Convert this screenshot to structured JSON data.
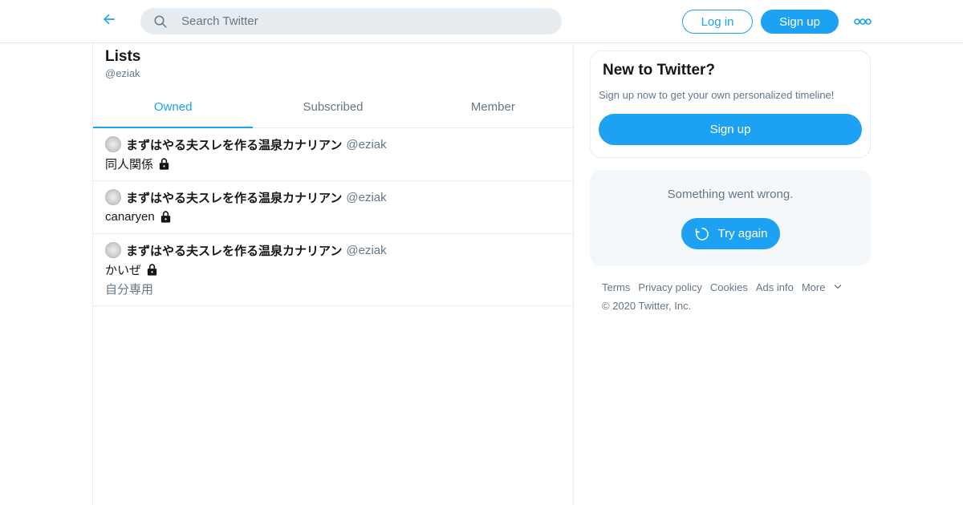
{
  "colors": {
    "accent": "#1da1f2",
    "text_primary": "#14171a",
    "text_secondary": "#657786",
    "border": "#e6ecf0",
    "search_bg": "#e6ecf0",
    "card_bg": "#f5f8fa"
  },
  "header": {
    "back_icon": "arrow-left-icon",
    "search": {
      "placeholder": "Search Twitter",
      "value": ""
    },
    "login_label": "Log in",
    "signup_label": "Sign up",
    "more_icon": "more-dots-icon"
  },
  "page": {
    "title": "Lists",
    "handle": "@eziak"
  },
  "tabs": [
    {
      "label": "Owned",
      "active": true
    },
    {
      "label": "Subscribed",
      "active": false
    },
    {
      "label": "Member",
      "active": false
    }
  ],
  "lists": [
    {
      "owner_name": "まずはやる夫スレを作る温泉カナリアン",
      "owner_handle": "@eziak",
      "name": "同人関係",
      "private": true,
      "description": ""
    },
    {
      "owner_name": "まずはやる夫スレを作る温泉カナリアン",
      "owner_handle": "@eziak",
      "name": "canaryen",
      "private": true,
      "description": ""
    },
    {
      "owner_name": "まずはやる夫スレを作る温泉カナリアン",
      "owner_handle": "@eziak",
      "name": "かいぜ",
      "private": true,
      "description": "自分専用"
    }
  ],
  "sidebar": {
    "signup_card": {
      "title": "New to Twitter?",
      "subtitle": "Sign up now to get your own personalized timeline!",
      "button_label": "Sign up"
    },
    "error_card": {
      "message": "Something went wrong.",
      "retry_label": "Try again",
      "retry_icon": "refresh-icon"
    },
    "footer": {
      "links": [
        "Terms",
        "Privacy policy",
        "Cookies",
        "Ads info"
      ],
      "more_label": "More",
      "copyright": "© 2020 Twitter, Inc."
    }
  }
}
